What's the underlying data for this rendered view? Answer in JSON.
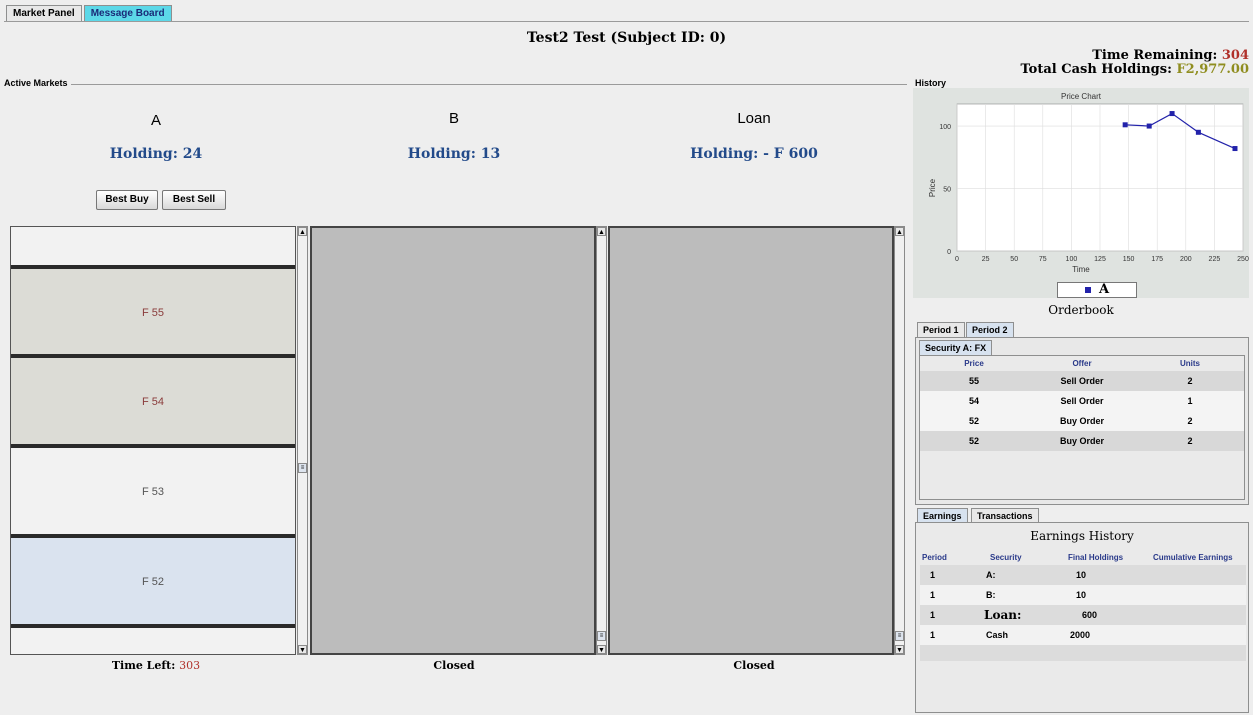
{
  "tabs": [
    {
      "label": "Market Panel"
    },
    {
      "label": "Message Board"
    }
  ],
  "header": {
    "title": "Test2 Test (Subject ID: 0)",
    "time_remaining_label": "Time Remaining:",
    "time_remaining_value": "304",
    "cash_label": "Total Cash Holdings:",
    "cash_value": "F2,977.00"
  },
  "markets": {
    "section_label": "Active Markets",
    "items": [
      {
        "name": "A",
        "holding": "Holding: 24",
        "status_label": "Time Left:",
        "status_value": "303"
      },
      {
        "name": "B",
        "holding": "Holding: 13",
        "status_label": "Closed",
        "status_value": ""
      },
      {
        "name": "Loan",
        "holding": "Holding: - F 600",
        "status_label": "Closed",
        "status_value": ""
      }
    ],
    "best_buy": "Best Buy",
    "best_sell": "Best Sell",
    "ladder": [
      {
        "label": "F 55"
      },
      {
        "label": "F 54"
      },
      {
        "label": "F 53"
      },
      {
        "label": "F 52"
      }
    ]
  },
  "history": {
    "label": "History",
    "chart_data": {
      "type": "line",
      "title": "Price Chart",
      "xlabel": "Time",
      "ylabel": "Price",
      "xlim": [
        0,
        250
      ],
      "ylim": [
        0,
        100
      ],
      "x_ticks": [
        0,
        25,
        50,
        75,
        100,
        125,
        150,
        175,
        200,
        225,
        250
      ],
      "y_ticks": [
        0,
        50,
        100
      ],
      "series": [
        {
          "name": "A",
          "x": [
            147,
            168,
            188,
            211,
            243
          ],
          "y": [
            101,
            100,
            110,
            95,
            82
          ]
        }
      ],
      "legend": "bottom",
      "colors": {
        "series": "#2222aa",
        "background": "#dfe3e0"
      }
    }
  },
  "orderbook": {
    "title": "Orderbook",
    "periods": [
      "Period 1",
      "Period 2"
    ],
    "security_tab": "Security A: FX",
    "columns": [
      "Price",
      "Offer",
      "Units"
    ],
    "rows": [
      {
        "price": "55",
        "offer": "Sell Order",
        "units": "2"
      },
      {
        "price": "54",
        "offer": "Sell Order",
        "units": "1"
      },
      {
        "price": "52",
        "offer": "Buy Order",
        "units": "2"
      },
      {
        "price": "52",
        "offer": "Buy Order",
        "units": "2"
      }
    ]
  },
  "earnings": {
    "tabs": [
      "Earnings",
      "Transactions"
    ],
    "title": "Earnings History",
    "columns": [
      "Period",
      "Security",
      "Final Holdings",
      "Cumulative Earnings"
    ],
    "rows": [
      {
        "period": "1",
        "security": "A:",
        "final": "10",
        "cumulative": ""
      },
      {
        "period": "1",
        "security": "B:",
        "final": "10",
        "cumulative": ""
      },
      {
        "period": "1",
        "security": "Loan:",
        "final": "600",
        "cumulative": ""
      },
      {
        "period": "1",
        "security": "Cash",
        "final": "2000",
        "cumulative": ""
      }
    ]
  }
}
